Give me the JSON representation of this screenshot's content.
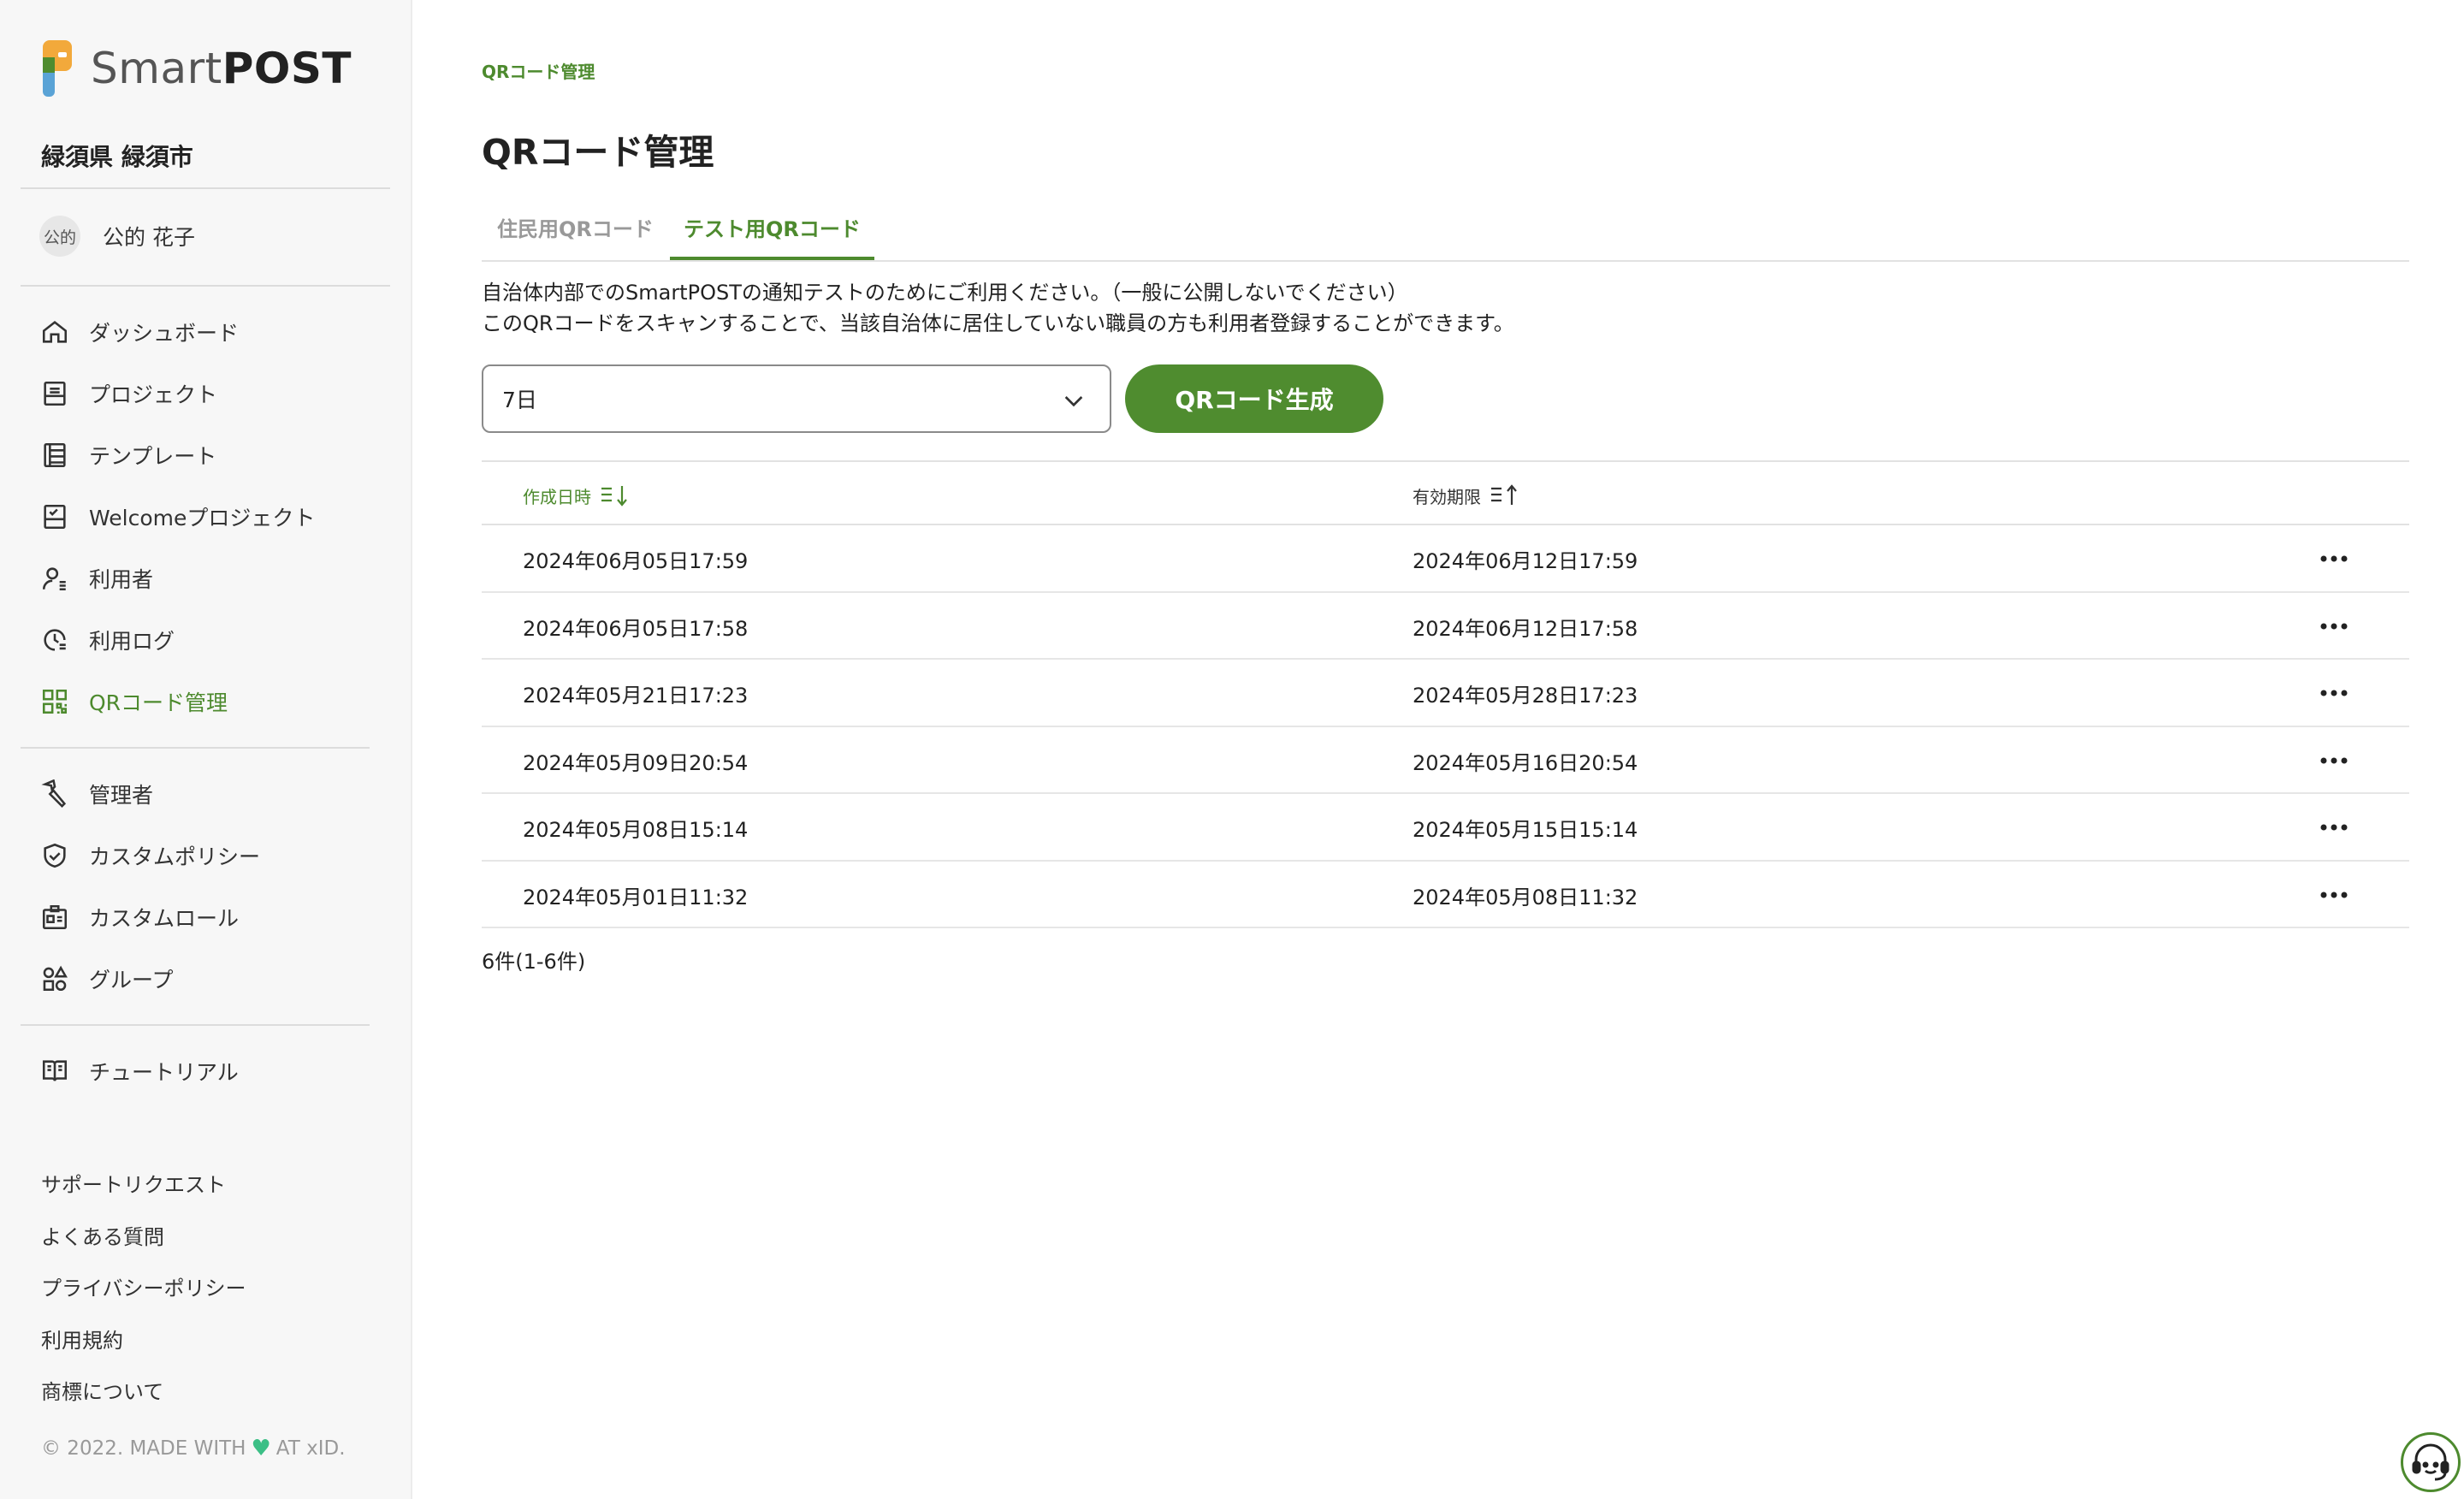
{
  "app": {
    "logo_text_light": "Smart",
    "logo_text_bold": "POST",
    "accent_color": "#4d8a2e"
  },
  "sidebar": {
    "org_name": "緑須県 緑須市",
    "user": {
      "avatar_text": "公的",
      "name": "公的 花子"
    },
    "nav_items": [
      {
        "label": "ダッシュボード",
        "icon": "home-icon"
      },
      {
        "label": "プロジェクト",
        "icon": "project-icon"
      },
      {
        "label": "テンプレート",
        "icon": "template-icon"
      },
      {
        "label": "Welcomeプロジェクト",
        "icon": "welcome-icon"
      },
      {
        "label": "利用者",
        "icon": "users-icon"
      },
      {
        "label": "利用ログ",
        "icon": "log-icon"
      },
      {
        "label": "QRコード管理",
        "icon": "qr-code-icon",
        "active": true
      }
    ],
    "admin_items": [
      {
        "label": "管理者",
        "icon": "wrench-icon"
      },
      {
        "label": "カスタムポリシー",
        "icon": "shield-icon"
      },
      {
        "label": "カスタムロール",
        "icon": "id-card-icon"
      },
      {
        "label": "グループ",
        "icon": "shapes-icon"
      }
    ],
    "extra_items": [
      {
        "label": "チュートリアル",
        "icon": "book-icon"
      }
    ],
    "footer_links": [
      "サポートリクエスト",
      "よくある質問",
      "プライバシーポリシー",
      "利用規約",
      "商標について"
    ],
    "copyright_prefix": "© 2022. MADE WITH",
    "copyright_suffix": "AT xID."
  },
  "main": {
    "breadcrumb": "QRコード管理",
    "title": "QRコード管理",
    "tabs": [
      {
        "label": "住民用QRコード",
        "active": false
      },
      {
        "label": "テスト用QRコード",
        "active": true
      }
    ],
    "description_line1": "自治体内部でのSmartPOSTの通知テストのためにご利用ください。（一般に公開しないでください）",
    "description_line2": "このQRコードをスキャンすることで、当該自治体に居住していない職員の方も利用者登録することができます。",
    "period_select_value": "7日",
    "generate_button": "QRコード生成",
    "table": {
      "columns": [
        "作成日時",
        "有効期限"
      ],
      "rows": [
        [
          "2024年06月05日17:59",
          "2024年06月12日17:59"
        ],
        [
          "2024年06月05日17:58",
          "2024年06月12日17:58"
        ],
        [
          "2024年05月21日17:23",
          "2024年05月28日17:23"
        ],
        [
          "2024年05月09日20:54",
          "2024年05月16日20:54"
        ],
        [
          "2024年05月08日15:14",
          "2024年05月15日15:14"
        ],
        [
          "2024年05月01日11:32",
          "2024年05月08日11:32"
        ]
      ]
    },
    "count_text": "6件(1-6件)"
  }
}
